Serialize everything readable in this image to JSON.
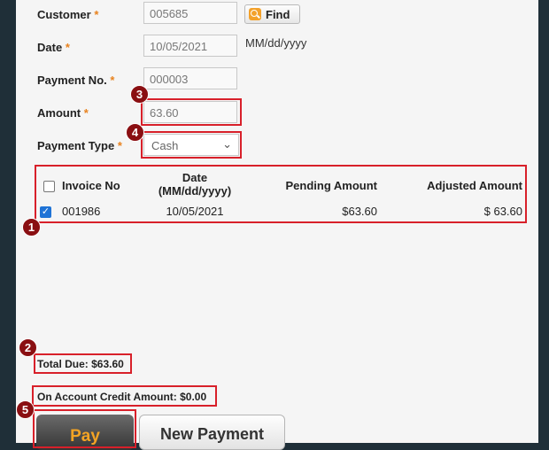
{
  "form": {
    "customer": {
      "label": "Customer",
      "required_mark": "*",
      "value": "005685",
      "find_label": "Find"
    },
    "date": {
      "label": "Date",
      "required_mark": "*",
      "value": "10/05/2021",
      "format_hint": "MM/dd/yyyy"
    },
    "payment_no": {
      "label": "Payment No.",
      "required_mark": "*",
      "value": "000003"
    },
    "amount": {
      "label": "Amount",
      "required_mark": "*",
      "value": "63.60"
    },
    "payment_type": {
      "label": "Payment Type",
      "required_mark": "*",
      "selected": "Cash"
    }
  },
  "table": {
    "headers": {
      "invoice_no": "Invoice No",
      "date_line1": "Date",
      "date_line2": "(MM/dd/yyyy)",
      "pending_amount": "Pending Amount",
      "adjusted_amount": "Adjusted Amount"
    },
    "rows": [
      {
        "checked": true,
        "invoice_no": "001986",
        "date": "10/05/2021",
        "pending_amount": "$63.60",
        "adjusted_amount": "$ 63.60"
      }
    ]
  },
  "totals": {
    "total_due": "Total Due: $63.60",
    "on_account_credit": "On Account Credit Amount: $0.00"
  },
  "buttons": {
    "pay": "Pay",
    "new_payment": "New Payment"
  },
  "annotations": {
    "b1": "1",
    "b2": "2",
    "b3": "3",
    "b4": "4",
    "b5": "5"
  },
  "colors": {
    "required": "#e8821e",
    "highlight": "#d8202a",
    "badge": "#8a0f12",
    "pay_text": "#f4a424",
    "checkbox": "#1f73d6"
  }
}
